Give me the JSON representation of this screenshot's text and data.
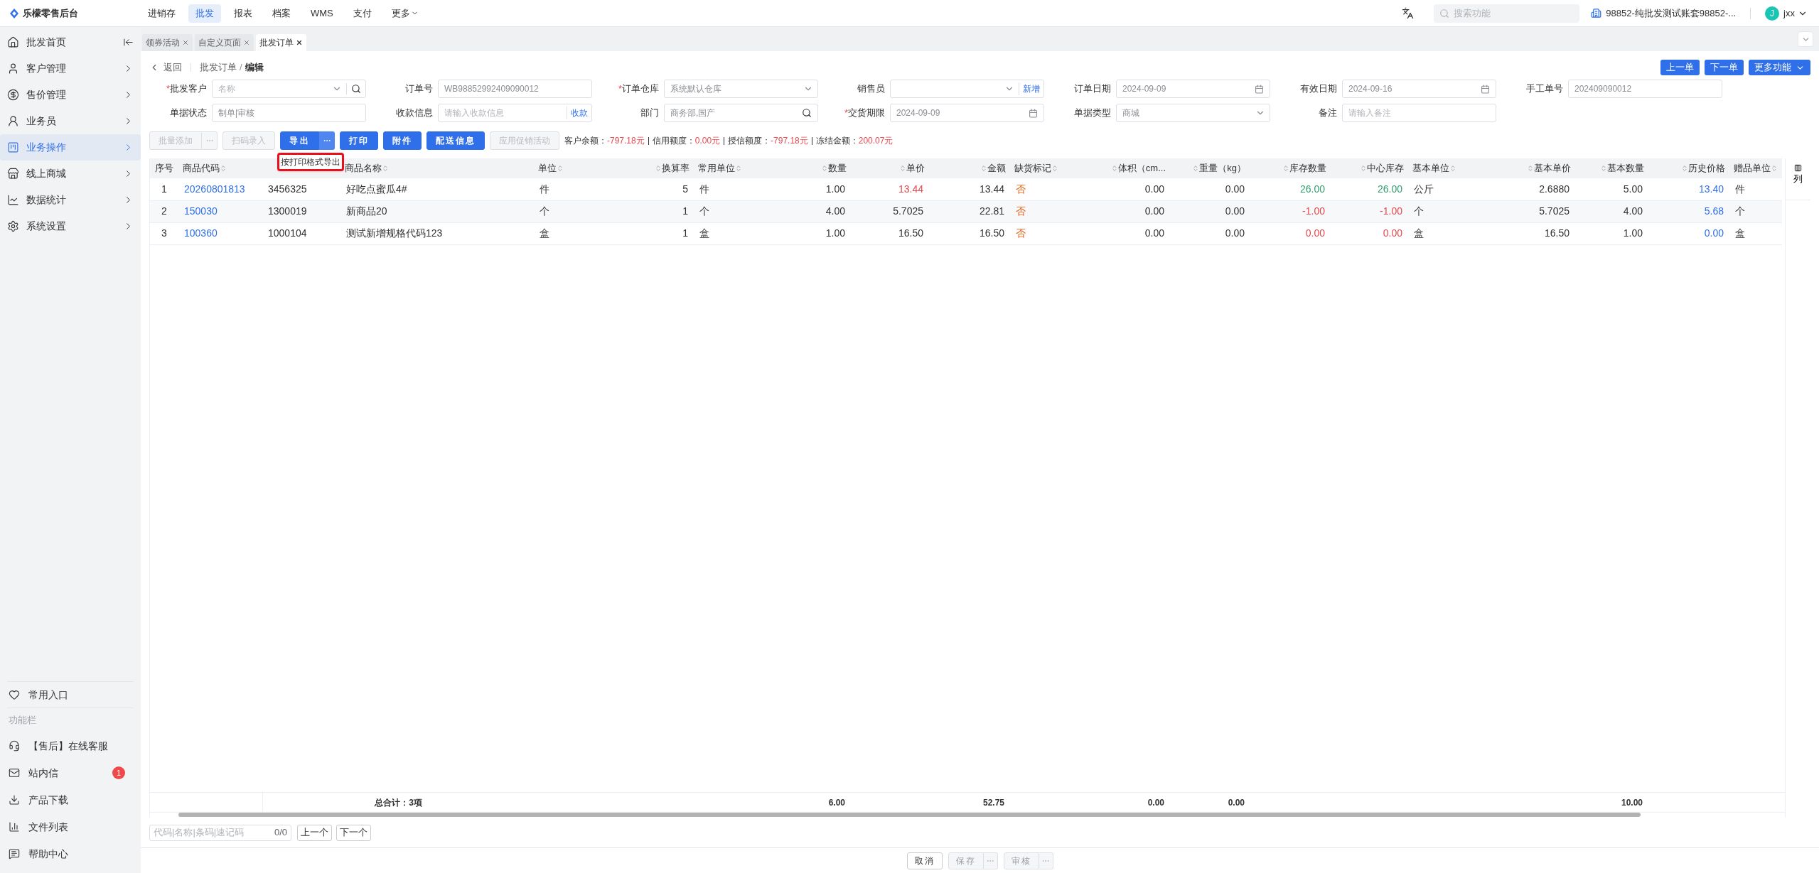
{
  "brand": {
    "name": "乐檬零售后台"
  },
  "top_nav": [
    {
      "label": "进销存",
      "selected": false
    },
    {
      "label": "批发",
      "selected": true
    },
    {
      "label": "报表",
      "selected": false
    },
    {
      "label": "档案",
      "selected": false
    },
    {
      "label": "WMS",
      "selected": false
    },
    {
      "label": "支付",
      "selected": false
    },
    {
      "label": "更多",
      "selected": false,
      "kind": "menu"
    }
  ],
  "top_right": {
    "search_placeholder": "搜索功能",
    "account": "98852-纯批发测试账套98852-...",
    "avatar_letter": "J",
    "user": "jxx"
  },
  "sidebar": {
    "items": [
      {
        "label": "批发首页",
        "kind": "collapse",
        "selected": false
      },
      {
        "label": "客户管理",
        "kind": "arrow",
        "selected": false
      },
      {
        "label": "售价管理",
        "kind": "arrow",
        "selected": false
      },
      {
        "label": "业务员",
        "kind": "arrow",
        "selected": false
      },
      {
        "label": "业务操作",
        "kind": "arrow",
        "selected": true
      },
      {
        "label": "线上商城",
        "kind": "arrow",
        "selected": false
      },
      {
        "label": "数据统计",
        "kind": "arrow",
        "selected": false
      },
      {
        "label": "系统设置",
        "kind": "arrow",
        "selected": false
      }
    ],
    "favorites": "常用入口",
    "section_title": "功能栏",
    "tools": [
      {
        "label": "【售后】在线客服"
      },
      {
        "label": "站内信",
        "badge": "1"
      },
      {
        "label": "产品下载"
      },
      {
        "label": "文件列表"
      },
      {
        "label": "帮助中心"
      }
    ]
  },
  "tabs": [
    {
      "label": "领券活动",
      "selected": false
    },
    {
      "label": "自定义页面",
      "selected": false
    },
    {
      "label": "批发订单",
      "selected": true
    }
  ],
  "breadcrumb": {
    "back": "返回",
    "path": [
      "批发订单",
      "编辑"
    ],
    "separator": "/"
  },
  "nav_buttons": [
    "上一单",
    "下一单"
  ],
  "more_button": "更多功能",
  "form_rows": [
    [
      {
        "label": "批发客户",
        "required_mark": "*",
        "placeholder": "名称",
        "kind": "select-search"
      },
      {
        "label": "订单号",
        "value": "WB98852992409090012",
        "kind": "text"
      },
      {
        "label": "订单仓库",
        "required_mark": "*",
        "value": "系统默认仓库",
        "kind": "select"
      },
      {
        "label": "销售员",
        "kind": "select-add",
        "action": "新增"
      },
      {
        "label": "订单日期",
        "value": "2024-09-09",
        "kind": "date"
      },
      {
        "label": "有效日期",
        "value": "2024-09-16",
        "kind": "date"
      },
      {
        "label": "手工单号",
        "value": "202409090012",
        "kind": "text"
      }
    ],
    [
      {
        "label": "单据状态",
        "value": "制单|审核",
        "kind": "text"
      },
      {
        "label": "收款信息",
        "placeholder": "请输入收款信息",
        "kind": "action",
        "action": "收款"
      },
      {
        "label": "部门",
        "value": "商务部,国产",
        "kind": "search"
      },
      {
        "label": "交货期限",
        "required_mark": "*",
        "value": "2024-09-09",
        "kind": "date"
      },
      {
        "label": "单据类型",
        "value": "商城",
        "kind": "select"
      },
      {
        "label": "备注",
        "placeholder": "请输入备注",
        "kind": "text"
      }
    ]
  ],
  "toolbar": [
    {
      "label": "批量添加",
      "kind": "split",
      "disabled": true
    },
    {
      "label": "扫码录入",
      "kind": "plain",
      "disabled": true
    },
    {
      "label": "导出",
      "kind": "split",
      "disabled": false
    },
    {
      "label": "打印",
      "kind": "plain",
      "disabled": false
    },
    {
      "label": "附件",
      "kind": "plain",
      "disabled": false
    },
    {
      "label": "配送信息",
      "kind": "plain",
      "disabled": false
    },
    {
      "label": "应用促销活动",
      "kind": "plain",
      "disabled": true
    }
  ],
  "tooltip": "按打印格式导出",
  "balances": [
    {
      "label": "客户余额：",
      "value": "-797.18元"
    },
    {
      "label": "信用额度：",
      "value": "0.00元"
    },
    {
      "label": "授信额度：",
      "value": "-797.18元"
    },
    {
      "label": "冻结金额：",
      "value": "200.07元"
    }
  ],
  "table": {
    "columns": [
      {
        "label": "序号",
        "kind": "index"
      },
      {
        "label": "商品代码",
        "kind": "text"
      },
      {
        "kind": "text"
      },
      {
        "label": "商品名称",
        "kind": "text"
      },
      {
        "label": "单位",
        "kind": "text"
      },
      {
        "label": "换算率",
        "kind": "number"
      },
      {
        "label": "常用单位",
        "kind": "text"
      },
      {
        "label": "数量",
        "kind": "number",
        "total": "6.00"
      },
      {
        "label": "单价",
        "kind": "number"
      },
      {
        "label": "金额",
        "kind": "number",
        "total": "52.75"
      },
      {
        "label": "缺货标记",
        "kind": "flag"
      },
      {
        "label": "体积（cm...",
        "kind": "number",
        "total": "0.00"
      },
      {
        "label": "重量（kg）",
        "kind": "number",
        "total": "0.00"
      },
      {
        "label": "库存数量",
        "kind": "number"
      },
      {
        "label": "中心库存",
        "kind": "number"
      },
      {
        "label": "基本单位",
        "kind": "text"
      },
      {
        "label": "基本单价",
        "kind": "number"
      },
      {
        "label": "基本数量",
        "kind": "number",
        "total": "10.00"
      },
      {
        "label": "历史价格",
        "kind": "number"
      },
      {
        "label": "赠品单位",
        "kind": "text"
      }
    ],
    "column_settings": "列",
    "rows": [
      [
        "1",
        {
          "text": "20260801813",
          "color": "#2f6fea"
        },
        "3456325",
        "好吃点蜜瓜4#",
        "件",
        "5",
        "件",
        "1.00",
        {
          "text": "13.44",
          "color": "#e5484d"
        },
        "13.44",
        "否",
        "0.00",
        "0.00",
        {
          "text": "26.00",
          "color": "#2f9e6e"
        },
        {
          "text": "26.00",
          "color": "#2f9e6e"
        },
        "公斤",
        "2.6880",
        "5.00",
        {
          "text": "13.40",
          "color": "#2f6fea"
        },
        "件"
      ],
      [
        "2",
        {
          "text": "150030",
          "color": "#2f6fea"
        },
        "1300019",
        "新商品20",
        "个",
        "1",
        "个",
        "4.00",
        "5.7025",
        "22.81",
        "否",
        "0.00",
        "0.00",
        {
          "text": "-1.00",
          "color": "#e5484d"
        },
        {
          "text": "-1.00",
          "color": "#e5484d"
        },
        "个",
        "5.7025",
        "4.00",
        {
          "text": "5.68",
          "color": "#2f6fea"
        },
        "个"
      ],
      [
        "3",
        {
          "text": "100360",
          "color": "#2f6fea"
        },
        "1000104",
        "测试新增规格代码123",
        "盒",
        "1",
        "盒",
        "1.00",
        "16.50",
        "16.50",
        "否",
        "0.00",
        "0.00",
        {
          "text": "0.00",
          "color": "#e5484d"
        },
        {
          "text": "0.00",
          "color": "#e5484d"
        },
        "盒",
        "16.50",
        "1.00",
        {
          "text": "0.00",
          "color": "#2f6fea"
        },
        "盒"
      ]
    ],
    "totals_label": "总合计：3项"
  },
  "finder": {
    "placeholder": "代码|名称|条码|速记码",
    "count": "0/0",
    "prev": "上一个",
    "next": "下一个"
  },
  "footer": [
    {
      "label": "取消",
      "disabled": false,
      "more": false
    },
    {
      "label": "保存",
      "disabled": true,
      "more": true
    },
    {
      "label": "审核",
      "disabled": true,
      "more": true
    }
  ]
}
